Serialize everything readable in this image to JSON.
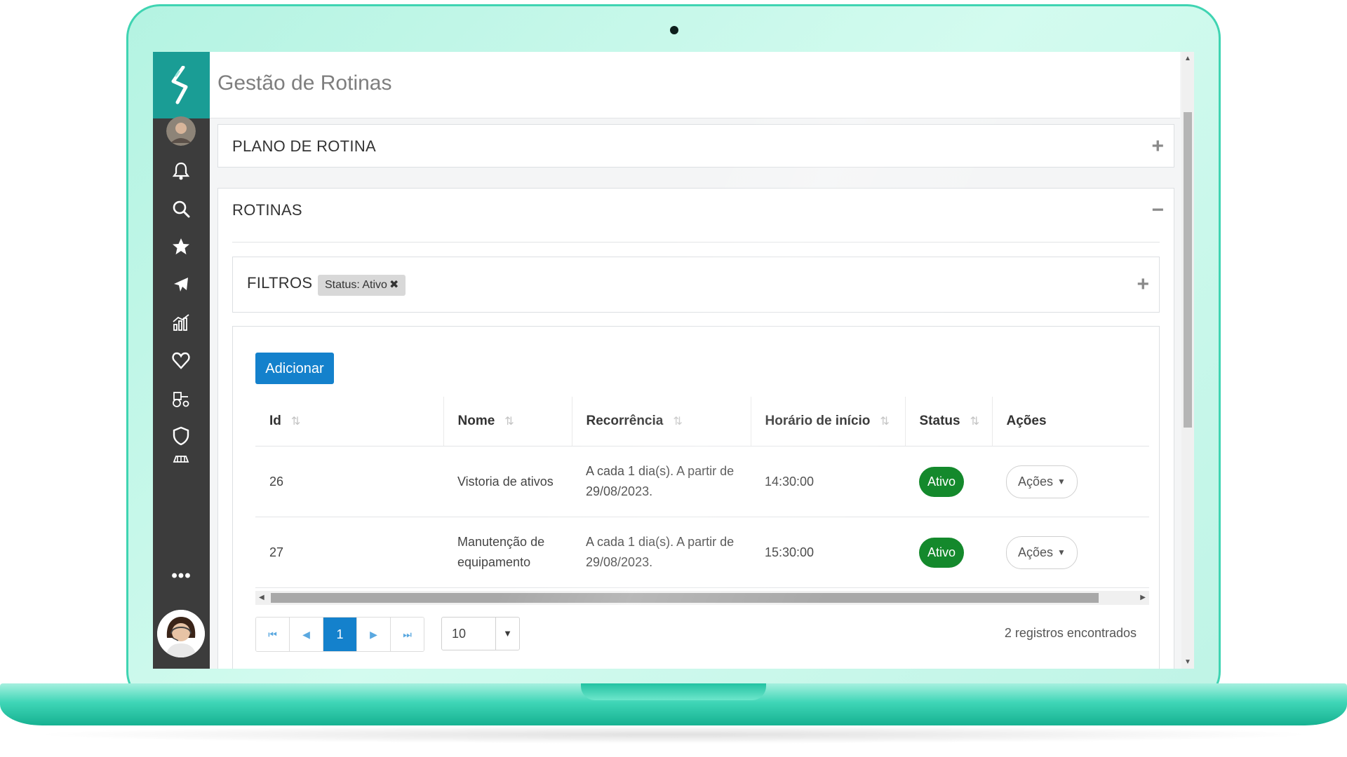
{
  "app": {
    "page_title": "Gestão de Rotinas"
  },
  "colors": {
    "sidebar_logo": "#1a9d95",
    "sidebar_bg": "#3c3c3c",
    "primary_button": "#1481cc",
    "status_active": "#14892c"
  },
  "sidebar": {
    "icons": [
      "user-avatar",
      "bell-icon",
      "search-icon",
      "star-icon",
      "plane-icon",
      "chart-icon",
      "heart-icon",
      "tractor-icon",
      "shield-icon",
      "vehicle-icon"
    ],
    "more_label": "•••"
  },
  "plano_panel": {
    "title": "PLANO DE ROTINA",
    "toggle": "+"
  },
  "rotinas_panel": {
    "title": "ROTINAS",
    "toggle": "−"
  },
  "filters": {
    "title": "FILTROS",
    "badge": "Status: Ativo",
    "badge_remove": "✖",
    "toggle": "+"
  },
  "toolbar": {
    "add_label": "Adicionar"
  },
  "table": {
    "columns": [
      "Id",
      "Nome",
      "Recorrência",
      "Horário de início",
      "Status",
      "Ações"
    ],
    "sort_glyph": "⇅",
    "rows": [
      {
        "id": "26",
        "nome": "Vistoria de ativos",
        "recorrencia": "A cada 1 dia(s). A partir de 29/08/2023.",
        "horario": "14:30:00",
        "status": "Ativo",
        "acoes": "Ações"
      },
      {
        "id": "27",
        "nome": "Manutenção de equipamento",
        "recorrencia": "A cada 1 dia(s). A partir de 29/08/2023.",
        "horario": "15:30:00",
        "status": "Ativo",
        "acoes": "Ações"
      }
    ]
  },
  "pagination": {
    "first": "⏮",
    "prev": "◀",
    "current_page": "1",
    "next": "▶",
    "last": "⏭",
    "page_size": "10",
    "records_text": "2 registros encontrados"
  }
}
